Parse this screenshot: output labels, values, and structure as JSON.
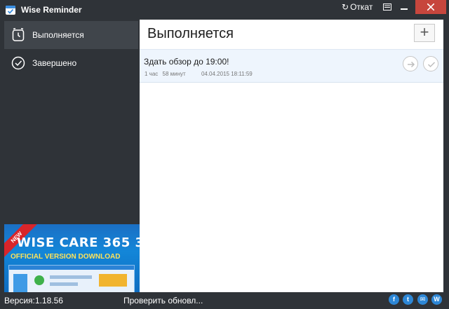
{
  "window": {
    "title": "Wise Reminder",
    "undo_label": "Откат",
    "icons": {
      "app": "calendar-check-icon",
      "undo": "undo-icon",
      "menu": "menu-icon",
      "minimize": "minimize-icon",
      "close": "close-icon"
    }
  },
  "sidebar": {
    "items": [
      {
        "label": "Выполняется",
        "icon": "alarm-clock-icon",
        "active": true
      },
      {
        "label": "Завершено",
        "icon": "check-circle-icon",
        "active": false
      }
    ]
  },
  "ad": {
    "ribbon": "NEW",
    "title": "WISE CARE 365 3",
    "subtitle": "OFFICIAL VERSION DOWNLOAD"
  },
  "main": {
    "title": "Выполняется",
    "add_button": "+",
    "tasks": [
      {
        "title": "Здать обзор до 19:00!",
        "remaining_hours": "1 час",
        "remaining_minutes": "58 минут",
        "datetime": "04.04.2015 18:11:59"
      }
    ]
  },
  "statusbar": {
    "version": "Версия:1.18.56",
    "check_updates": "Проверить обновл...",
    "social": [
      "f",
      "t",
      "✉",
      "W"
    ]
  },
  "colors": {
    "chrome": "#2f3338",
    "active_item": "#40454b",
    "close_button": "#c7463d",
    "task_row": "#eef5fd",
    "social": "#2d87d6"
  }
}
